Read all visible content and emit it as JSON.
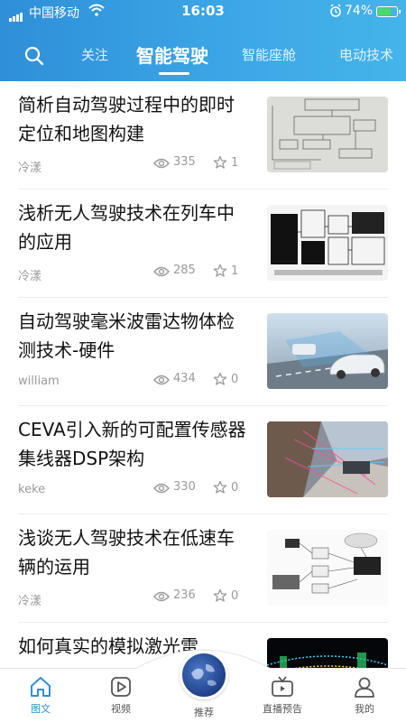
{
  "status_bar": {
    "carrier": "中国移动",
    "time": "16:03",
    "battery": "74%",
    "battery_level": 0.74
  },
  "nav": {
    "search_icon": "search-icon",
    "tabs": [
      {
        "label": "关注",
        "active": false
      },
      {
        "label": "智能驾驶",
        "active": true
      },
      {
        "label": "智能座舱",
        "active": false
      },
      {
        "label": "电动技术",
        "active": false
      }
    ]
  },
  "articles": [
    {
      "title": "简析自动驾驶过程中的即时定位和地图构建",
      "author": "冷漾",
      "views": "335",
      "likes": "1",
      "thumb": "diagram-scan"
    },
    {
      "title": "浅析无人驾驶技术在列车中的应用",
      "author": "冷漾",
      "views": "285",
      "likes": "1",
      "thumb": "train-diagram"
    },
    {
      "title": "自动驾驶毫米波雷达物体检测技术-硬件",
      "author": "william",
      "views": "434",
      "likes": "0",
      "thumb": "radar-car"
    },
    {
      "title": "CEVA引入新的可配置传感器集线器DSP架构",
      "author": "keke",
      "views": "330",
      "likes": "0",
      "thumb": "sensor-street"
    },
    {
      "title": "浅谈无人驾驶技术在低速车辆的运用",
      "author": "冷漾",
      "views": "236",
      "likes": "0",
      "thumb": "network-diagram"
    },
    {
      "title": "如何真实的模拟激光雷",
      "author": "",
      "views": "",
      "likes": "",
      "thumb": "lidar-points"
    }
  ],
  "tabbar": {
    "items": [
      {
        "label": "图文",
        "icon": "home-icon",
        "active": true
      },
      {
        "label": "视频",
        "icon": "play-icon",
        "active": false
      },
      {
        "label": "推荐",
        "icon": "globe-icon",
        "active": false
      },
      {
        "label": "直播预告",
        "icon": "tv-icon",
        "active": false
      },
      {
        "label": "我的",
        "icon": "user-icon",
        "active": false
      }
    ]
  },
  "colors": {
    "header_start": "#2f8fd8",
    "header_end": "#45b4ea",
    "active_tab": "#2f8fd8",
    "battery": "#4cd964"
  }
}
